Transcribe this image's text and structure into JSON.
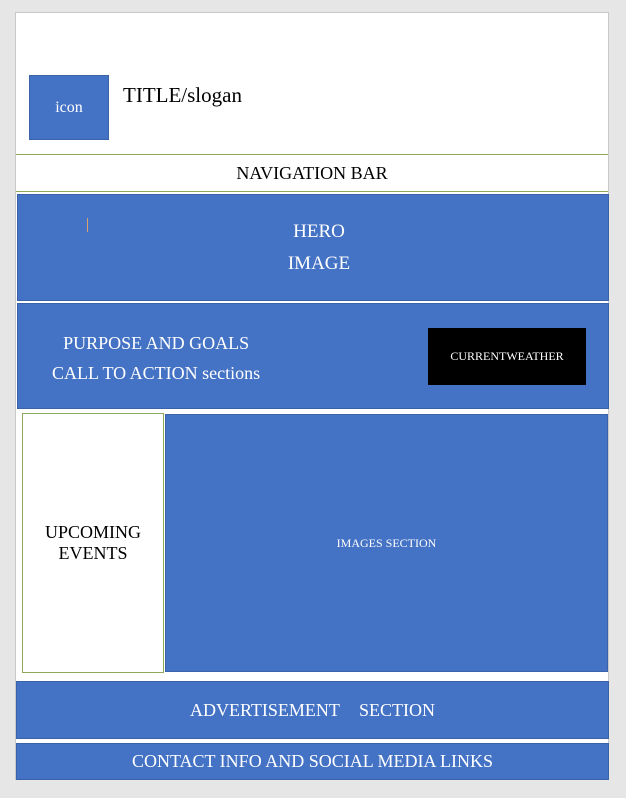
{
  "header": {
    "icon_label": "icon",
    "title": "TITLE/slogan"
  },
  "nav": {
    "label": "NAVIGATION BAR"
  },
  "hero": {
    "line1": "HERO",
    "line2": "IMAGE"
  },
  "purpose": {
    "line1": "PURPOSE AND GOALS",
    "line2": "CALL TO ACTION sections"
  },
  "weather": {
    "label": "CURRENTWEATHER"
  },
  "events": {
    "line1": "UPCOMING",
    "line2": "EVENTS"
  },
  "images": {
    "label": "IMAGES SECTION"
  },
  "advertisement": {
    "label": "ADVERTISEMENT   SECTION"
  },
  "contact": {
    "label": "CONTACT INFO AND SOCIAL MEDIA LINKS"
  },
  "colors": {
    "block_blue": "#4472c4",
    "weather_black": "#000000",
    "border_green": "#8fa85a"
  }
}
